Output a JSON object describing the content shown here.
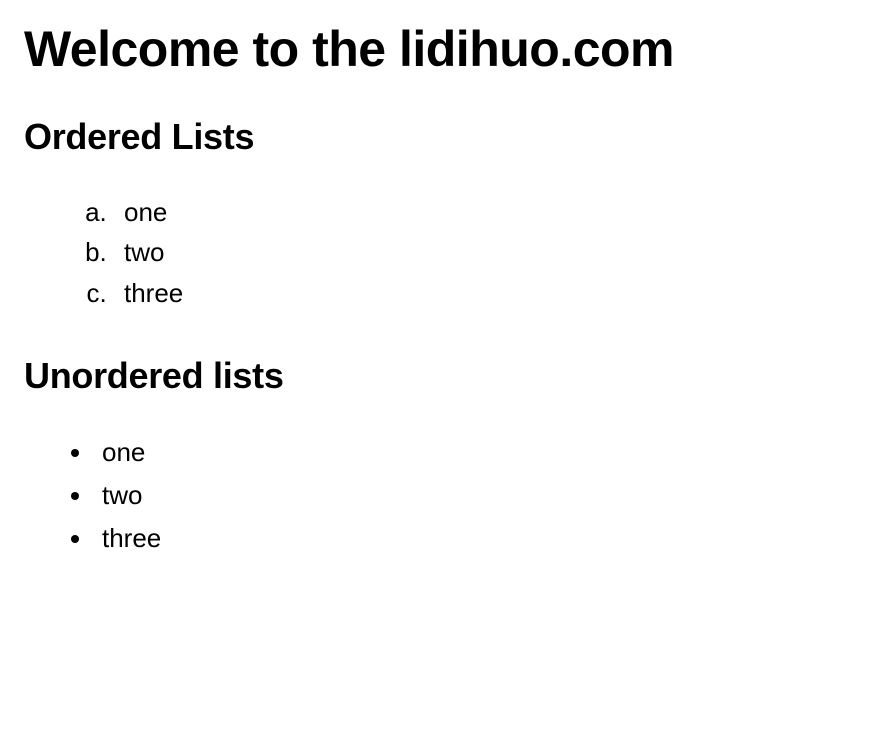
{
  "heading": "Welcome to the lidihuo.com",
  "ordered": {
    "title": "Ordered Lists",
    "items": [
      "one",
      "two",
      "three"
    ]
  },
  "unordered": {
    "title": "Unordered lists",
    "items": [
      "one",
      "two",
      "three"
    ]
  }
}
